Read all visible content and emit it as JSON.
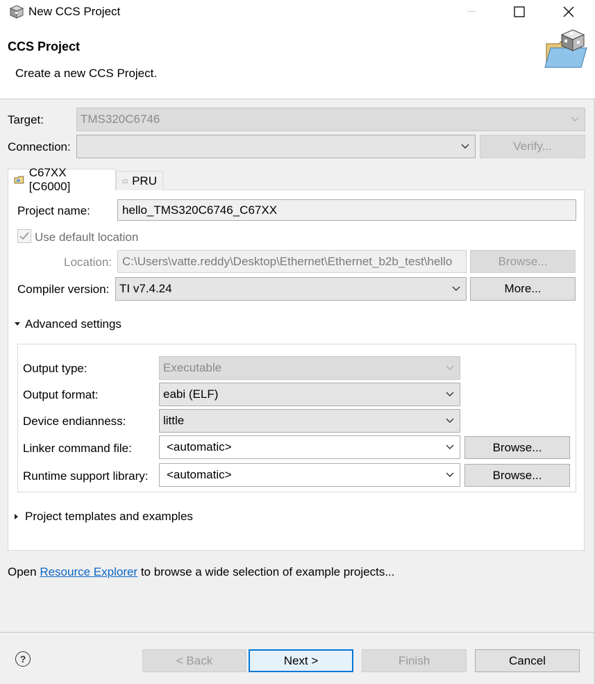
{
  "window": {
    "title": "New CCS Project",
    "icon": "cube-icon"
  },
  "banner": {
    "title": "CCS Project",
    "description": "Create a new CCS Project.",
    "image": "folder-cube-icon"
  },
  "target": {
    "label": "Target:",
    "value": "TMS320C6746"
  },
  "connection": {
    "label": "Connection:",
    "value": "",
    "verify_label": "Verify..."
  },
  "tabs": [
    {
      "label": "C67XX [C6000]",
      "active": true
    },
    {
      "label": "PRU",
      "active": false
    }
  ],
  "project": {
    "name_label": "Project name:",
    "name_value": "hello_TMS320C6746_C67XX",
    "use_default_label": "Use default location",
    "use_default_checked": true,
    "location_label": "Location:",
    "location_value": "C:\\Users\\vatte.reddy\\Desktop\\Ethernet\\Ethernet_b2b_test\\hello",
    "browse_label": "Browse...",
    "compiler_label": "Compiler version:",
    "compiler_value": "TI v7.4.24",
    "more_label": "More..."
  },
  "advanced": {
    "header": "Advanced settings",
    "expanded": true,
    "output_type_label": "Output type:",
    "output_type_value": "Executable",
    "output_format_label": "Output format:",
    "output_format_value": "eabi (ELF)",
    "endianness_label": "Device endianness:",
    "endianness_value": "little",
    "linker_label": "Linker command file:",
    "linker_value": "<automatic>",
    "linker_browse": "Browse...",
    "runtime_label": "Runtime support library:",
    "runtime_value": "<automatic>",
    "runtime_browse": "Browse..."
  },
  "templates": {
    "header": "Project templates and examples",
    "expanded": false
  },
  "footer_note": {
    "prefix": "Open ",
    "link": "Resource Explorer",
    "suffix": " to browse a wide selection of example projects..."
  },
  "buttons": {
    "back": "< Back",
    "next": "Next >",
    "finish": "Finish",
    "cancel": "Cancel"
  }
}
